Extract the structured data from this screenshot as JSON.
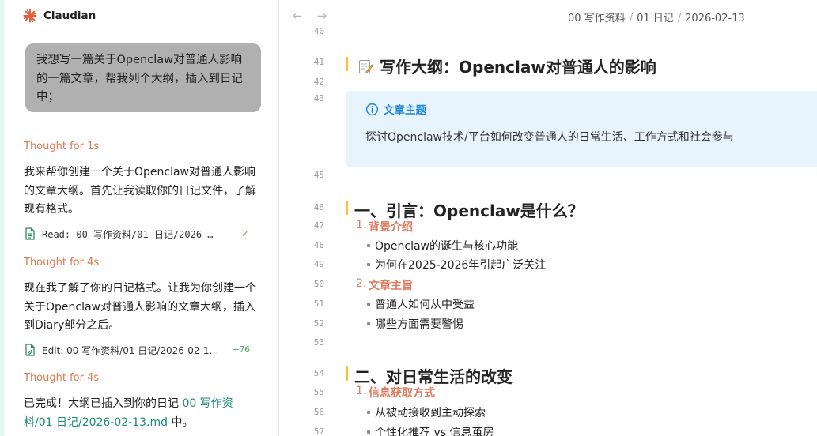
{
  "app": {
    "name": "Claudian"
  },
  "chat": {
    "user_message": "我想写一篇关于Openclaw对普通人影响的一篇文章，帮我列个大纲，插入到日记中；",
    "thought_1": "Thought for 1s",
    "reply_1": "我来帮你创建一个关于Openclaw对普通人影响的文章大纲。首先让我读取你的日记文件，了解现有格式。",
    "tool_read": "Read: 00 写作资料/01 日记/2026-…",
    "tool_read_status": "✓",
    "thought_2": "Thought for 4s",
    "reply_2": "现在我了解了你的日记格式。让我为你创建一个关于Openclaw对普通人影响的文章大纲，插入到Diary部分之后。",
    "tool_edit": "Edit: 00 写作资料/01 日记/2026-02-1…",
    "tool_edit_added": "+76",
    "thought_3": "Thought for 4s",
    "reply_3_prefix": "已完成！大纲已插入到你的日记 ",
    "reply_3_link": "00 写作资料/01 日记/2026-02-13.md",
    "reply_3_suffix": " 中。"
  },
  "editor": {
    "breadcrumb": [
      "00 写作资料",
      "01 日记",
      "2026-02-13"
    ],
    "line_numbers": {
      "l40": "40",
      "l41": "41",
      "l42": "42",
      "l43": "43",
      "l45": "45",
      "l46": "46",
      "l47": "47",
      "l48": "48",
      "l49": "49",
      "l50": "50",
      "l51": "51",
      "l52": "52",
      "l53": "53",
      "l54": "54",
      "l55": "55",
      "l56": "56",
      "l57": "57"
    },
    "heading_main": "写作大纲：Openclaw对普通人的影响",
    "callout": {
      "title": "文章主题",
      "body": "探讨Openclaw技术/平台如何改变普通人的日常生活、工作方式和社会参与"
    },
    "section_1": {
      "title": "一、引言：Openclaw是什么？",
      "item_1_num": "1.",
      "item_1": "背景介绍",
      "item_1_bullets": [
        "Openclaw的诞生与核心功能",
        "为何在2025-2026年引起广泛关注"
      ],
      "item_2_num": "2.",
      "item_2": "文章主旨",
      "item_2_bullets": [
        "普通人如何从中受益",
        "哪些方面需要警惕"
      ]
    },
    "section_2": {
      "title": "二、对日常生活的改变",
      "item_1_num": "1.",
      "item_1": "信息获取方式",
      "item_1_bullets": [
        "从被动接收到主动探索",
        "个性化推荐 vs 信息茧房"
      ]
    }
  },
  "colors": {
    "accent_orange": "#e07b62",
    "heading_bar": "#f2c230",
    "callout_bg": "#e7f3fd",
    "callout_title": "#1d86d6",
    "link": "#1a8a7a",
    "success_green": "#57b36c"
  },
  "icons": {
    "logo": "claudian-starburst-icon",
    "read_tool": "file-text-icon",
    "edit_tool": "file-edit-icon",
    "check": "check-icon",
    "memo": "memo-icon",
    "info": "info-icon",
    "back": "arrow-left-icon",
    "forward": "arrow-right-icon"
  }
}
